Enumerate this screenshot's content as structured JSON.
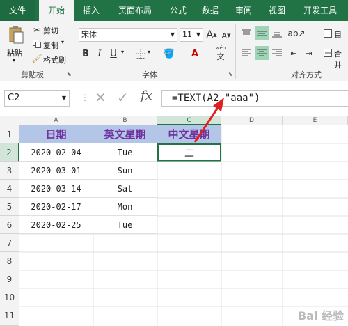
{
  "ribbon_tabs": [
    "文件",
    "开始",
    "插入",
    "页面布局",
    "公式",
    "数据",
    "审阅",
    "视图",
    "开发工具"
  ],
  "clipboard": {
    "paste": "粘贴",
    "cut": "剪切",
    "copy": "复制",
    "format_painter": "格式刷",
    "group_label": "剪贴板"
  },
  "font": {
    "name": "宋体",
    "size": "11",
    "grow": "A",
    "shrink": "A",
    "bold": "B",
    "italic": "I",
    "underline": "U",
    "group_label": "字体",
    "phonetic": "wén"
  },
  "alignment": {
    "group_label": "对齐方式",
    "wrap": "自",
    "merge": "合并"
  },
  "formula_bar": {
    "name_box": "C2",
    "fx": "fx",
    "formula": "=TEXT(A2,\"aaa\")"
  },
  "columns": [
    "A",
    "B",
    "C",
    "D",
    "E"
  ],
  "rows": [
    "1",
    "2",
    "3",
    "4",
    "5",
    "6",
    "7",
    "8",
    "9",
    "10",
    "11"
  ],
  "table": {
    "headers": [
      "日期",
      "英文星期",
      "中文星期"
    ],
    "dates": [
      "2020-02-04",
      "2020-03-01",
      "2020-03-14",
      "2020-02-17",
      "2020-02-25"
    ],
    "weekdays_en": [
      "Tue",
      "Sun",
      "Sat",
      "Mon",
      "Tue"
    ],
    "c2_value": "二"
  },
  "colors": {
    "excel_green": "#217346",
    "header_fill": "#b4c6e7",
    "header_text": "#7030a0",
    "arrow": "#e02020"
  },
  "watermark": "Bai 经验"
}
